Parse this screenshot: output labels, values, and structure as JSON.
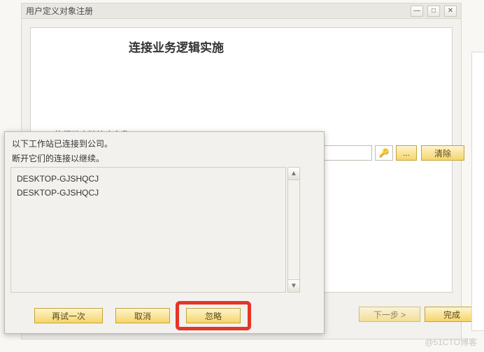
{
  "main": {
    "title": "用户定义对象注册",
    "heading": "连接业务逻辑实施",
    "field_label": "执行动态链接库名称",
    "path_value": "",
    "browse_label": "...",
    "clear_label": "清除",
    "next_label": "下一步 >",
    "finish_label": "完成"
  },
  "dialog": {
    "line1": "以下工作站已连接到公司。",
    "line2": "断开它们的连接以继续。",
    "workstations": [
      "DESKTOP-GJSHQCJ",
      "DESKTOP-GJSHQCJ"
    ],
    "retry_label": "再试一次",
    "cancel_label": "取消",
    "ignore_label": "忽略"
  },
  "watermark": "@51CTO博客"
}
